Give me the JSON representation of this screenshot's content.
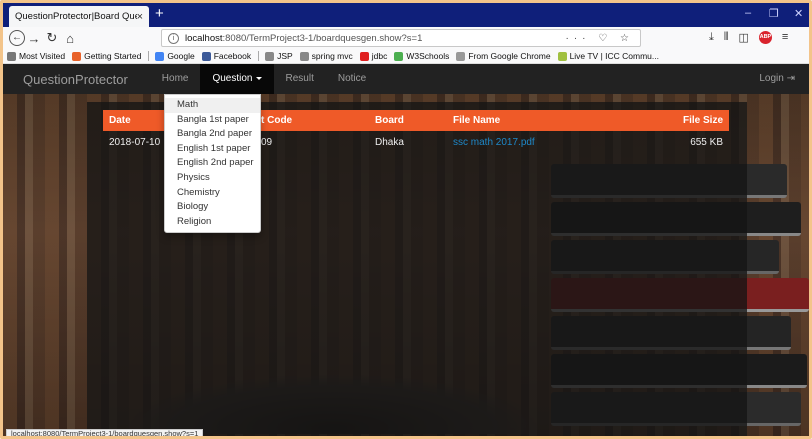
{
  "browser": {
    "tab_title": "QuestionProtector|Board Question",
    "tab_close": "×",
    "new_tab": "+",
    "window_controls": {
      "minimize": "–",
      "maximize": "❐",
      "close": "✕"
    },
    "url_host": "localhost",
    "url_rest": ":8080/TermProject3-1/boardquesgen.show?s=1",
    "url_actions": "··· ♡ ☆",
    "bookmarks": [
      {
        "label": "Most Visited",
        "color": "#777"
      },
      {
        "label": "Getting Started",
        "color": "#e8622a"
      },
      {
        "label": "Google",
        "color": "#4285f4"
      },
      {
        "label": "Facebook",
        "color": "#3b5998"
      },
      {
        "label": "JSP",
        "color": "#888"
      },
      {
        "label": "spring mvc",
        "color": "#888"
      },
      {
        "label": "jdbc",
        "color": "#e02020"
      },
      {
        "label": "W3Schools",
        "color": "#4caf50"
      },
      {
        "label": "From Google Chrome",
        "color": "#999"
      },
      {
        "label": "Live TV | ICC Commu...",
        "color": "#a0c040"
      }
    ],
    "status_url": "localhost:8080/TermProject3-1/boardquesgen.show?s=1"
  },
  "app": {
    "brand": "QuestionProtector",
    "nav": [
      "Home",
      "Question",
      "Result",
      "Notice"
    ],
    "login": "Login"
  },
  "table": {
    "headers": [
      "Date",
      "t Code",
      "Board",
      "File Name",
      "File Size"
    ],
    "rows": [
      [
        "2018-07-10",
        "09",
        "Dhaka",
        "ssc math 2017.pdf",
        "655 KB"
      ]
    ]
  },
  "dropdown": {
    "items": [
      "Math",
      "Bangla 1st paper",
      "Bangla 2nd paper",
      "English 1st paper",
      "English 2nd paper",
      "Physics",
      "Chemistry",
      "Biology",
      "Religion"
    ]
  }
}
